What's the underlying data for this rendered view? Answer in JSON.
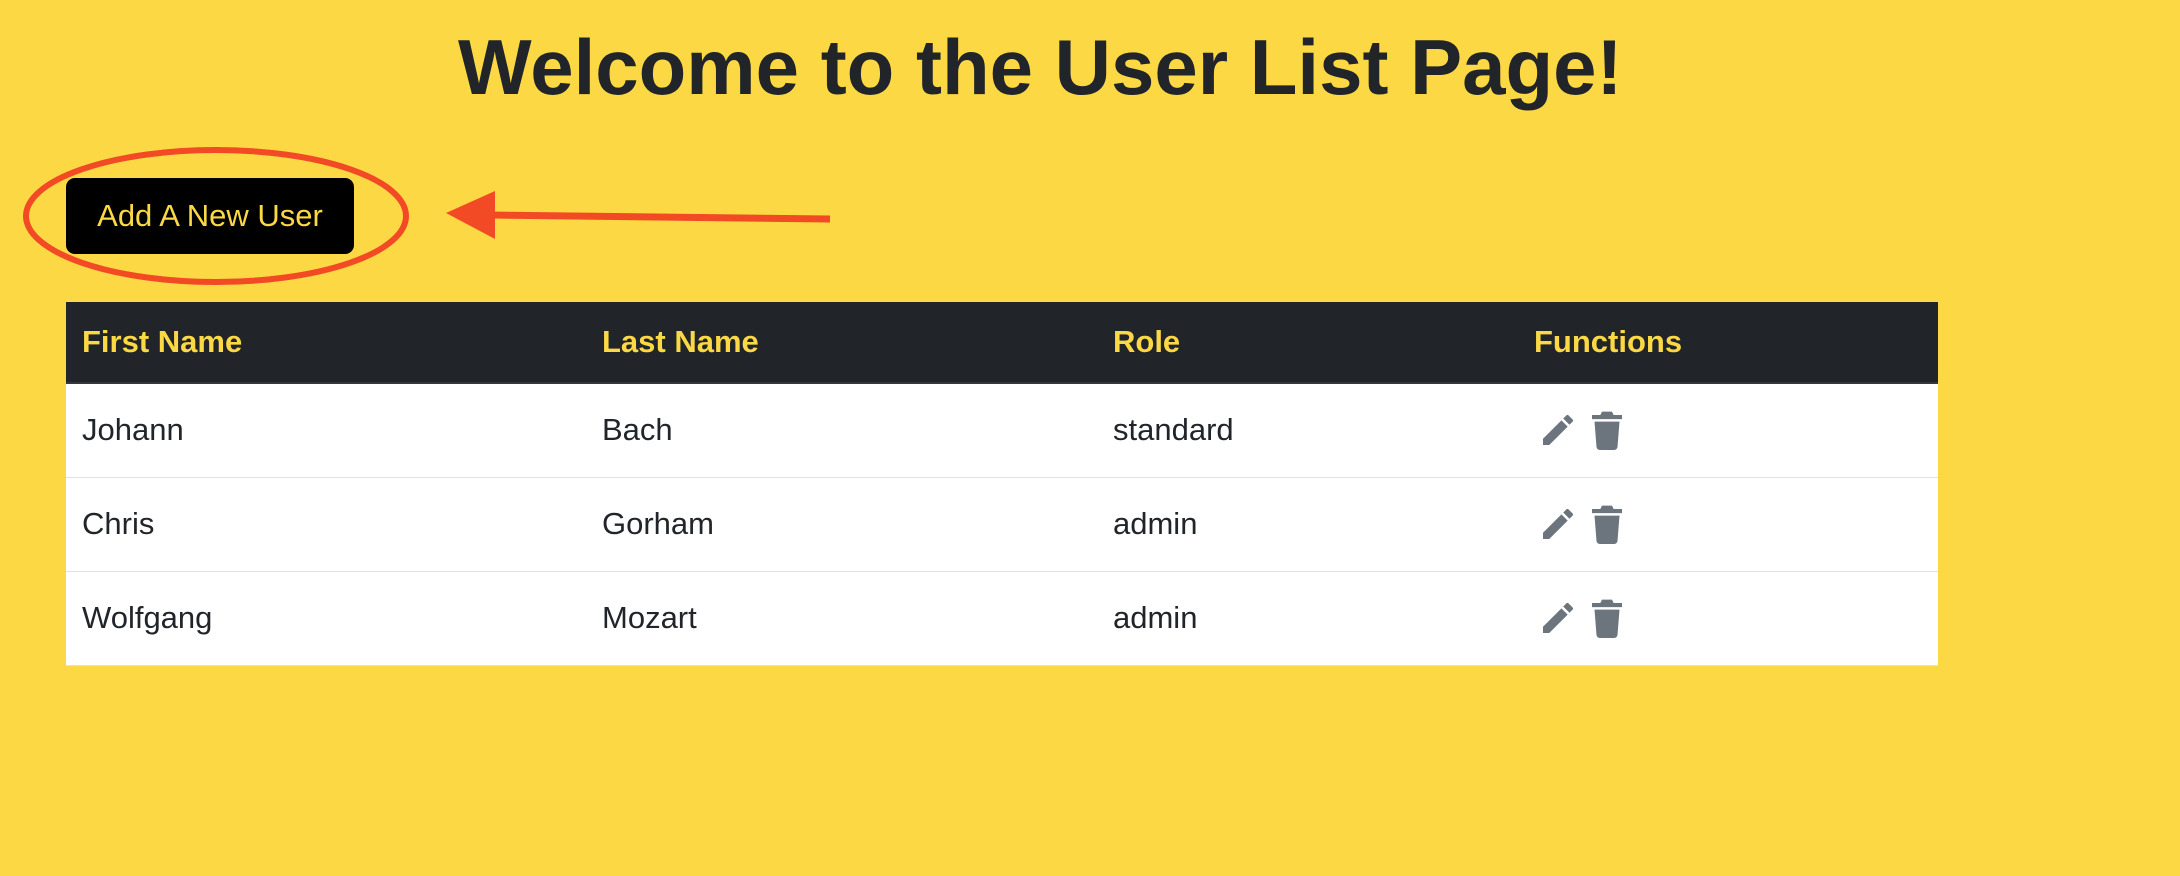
{
  "page": {
    "title": "Welcome to the User List Page!",
    "background_color": "#FCD944"
  },
  "toolbar": {
    "add_user_label": "Add A New User",
    "add_user_bg_color": "#000000",
    "add_user_text_color": "#FCD944"
  },
  "annotation": {
    "color": "#F24A24",
    "ellipse_target": "add-user-button",
    "arrow_points_to": "add-user-button"
  },
  "table": {
    "header_bg_color": "#212529",
    "header_text_color": "#FCD944",
    "cell_text_color": "#212529",
    "icon_color": "#6C757D",
    "columns": [
      "First Name",
      "Last Name",
      "Role",
      "Functions"
    ],
    "rows": [
      {
        "first_name": "Johann",
        "last_name": "Bach",
        "role": "standard",
        "functions": [
          "edit-icon",
          "delete-icon"
        ]
      },
      {
        "first_name": "Chris",
        "last_name": "Gorham",
        "role": "admin",
        "functions": [
          "edit-icon",
          "delete-icon"
        ]
      },
      {
        "first_name": "Wolfgang",
        "last_name": "Mozart",
        "role": "admin",
        "functions": [
          "edit-icon",
          "delete-icon"
        ]
      }
    ]
  }
}
